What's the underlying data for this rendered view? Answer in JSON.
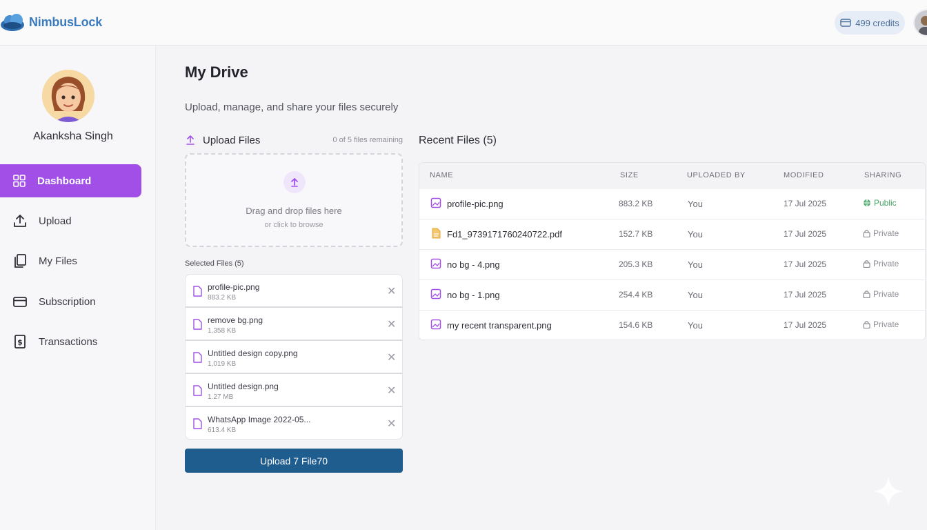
{
  "header": {
    "brand": "NimbusLock",
    "credits": "499 credits"
  },
  "sidebar": {
    "user_name": "Akanksha Singh",
    "items": [
      {
        "label": "Dashboard",
        "icon": "grid-icon",
        "active": true
      },
      {
        "label": "Upload",
        "icon": "upload-icon",
        "active": false
      },
      {
        "label": "My Files",
        "icon": "files-icon",
        "active": false
      },
      {
        "label": "Subscription",
        "icon": "card-icon",
        "active": false
      },
      {
        "label": "Transactions",
        "icon": "receipt-icon",
        "active": false
      }
    ]
  },
  "main": {
    "title": "My Drive",
    "subtitle": "Upload, manage, and share your files securely"
  },
  "upload": {
    "title": "Upload Files",
    "remaining": "0 of 5 files remaining",
    "drop_main": "Drag and drop files here",
    "drop_sub": "or click to browse",
    "selected_title": "Selected Files (5)",
    "selected": [
      {
        "name": "profile-pic.png",
        "size": "883.2 KB"
      },
      {
        "name": "remove bg.png",
        "size": "1,358 KB"
      },
      {
        "name": "Untitled design copy.png",
        "size": "1,019 KB"
      },
      {
        "name": "Untitled design.png",
        "size": "1.27 MB"
      },
      {
        "name": "WhatsApp Image 2022-05...",
        "size": "613.4 KB"
      }
    ],
    "button_label": "Upload 7 File70"
  },
  "recent": {
    "title": "Recent Files (5)",
    "columns": [
      "NAME",
      "SIZE",
      "UPLOADED BY",
      "MODIFIED",
      "SHARING"
    ],
    "rows": [
      {
        "name": "profile-pic.png",
        "size": "883.2 KB",
        "by": "You",
        "modified": "17 Jul 2025",
        "sharing": "Public",
        "type": "image"
      },
      {
        "name": "Fd1_9739171760240722.pdf",
        "size": "152.7 KB",
        "by": "You",
        "modified": "17 Jul 2025",
        "sharing": "Private",
        "type": "pdf"
      },
      {
        "name": "no bg - 4.png",
        "size": "205.3 KB",
        "by": "You",
        "modified": "17 Jul 2025",
        "sharing": "Private",
        "type": "image"
      },
      {
        "name": "no bg - 1.png",
        "size": "254.4 KB",
        "by": "You",
        "modified": "17 Jul 2025",
        "sharing": "Private",
        "type": "image"
      },
      {
        "name": "my recent transparent.png",
        "size": "154.6 KB",
        "by": "You",
        "modified": "17 Jul 2025",
        "sharing": "Private",
        "type": "image"
      }
    ]
  },
  "colors": {
    "accent": "#a24fe8",
    "brand": "#3a7bbf",
    "button": "#1f5d8f",
    "public": "#46a565"
  }
}
